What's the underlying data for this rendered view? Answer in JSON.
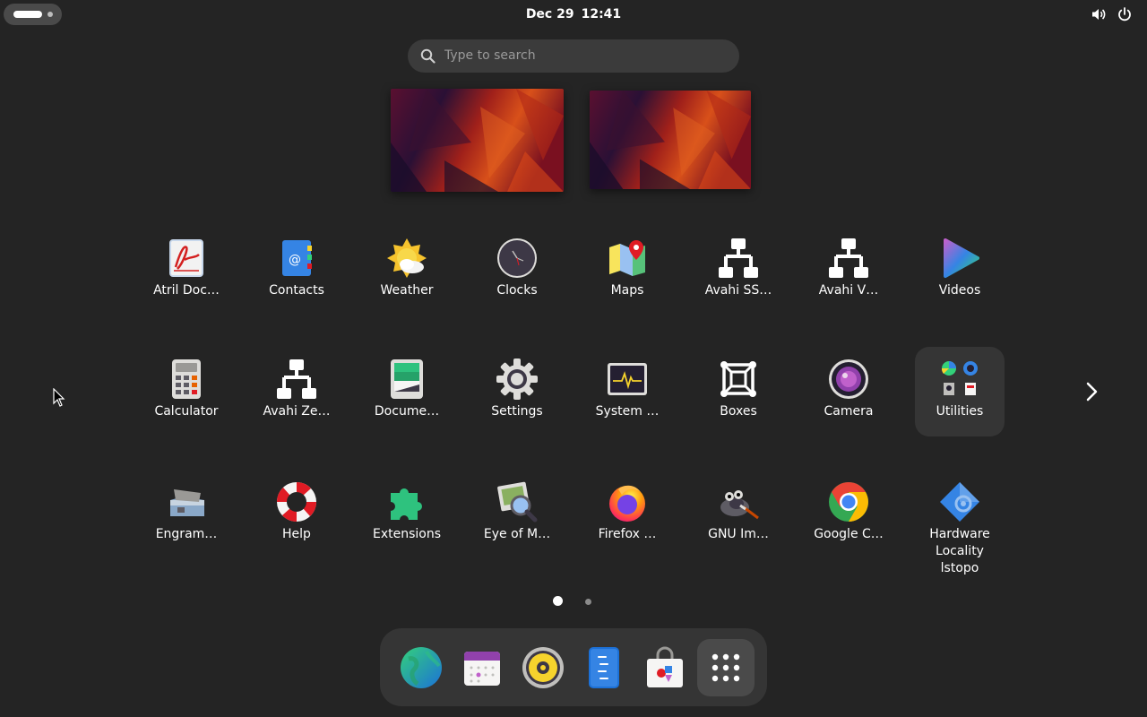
{
  "topbar": {
    "date": "Dec 29",
    "time": "12:41",
    "activities_icon": "activities-pill-icon",
    "volume_icon": "volume-icon",
    "power_icon": "power-icon"
  },
  "search": {
    "placeholder": "Type to search",
    "icon": "search-icon"
  },
  "workspaces": [
    {
      "name": "workspace-1"
    },
    {
      "name": "workspace-2"
    }
  ],
  "apps": [
    {
      "label": "Atril Doc…",
      "icon": "atril-document-viewer-icon"
    },
    {
      "label": "Contacts",
      "icon": "contacts-icon"
    },
    {
      "label": "Weather",
      "icon": "weather-icon"
    },
    {
      "label": "Clocks",
      "icon": "clocks-icon"
    },
    {
      "label": "Maps",
      "icon": "maps-icon"
    },
    {
      "label": "Avahi SS…",
      "icon": "network-icon"
    },
    {
      "label": "Avahi V…",
      "icon": "network-icon"
    },
    {
      "label": "Videos",
      "icon": "videos-icon"
    },
    {
      "label": "Calculator",
      "icon": "calculator-icon"
    },
    {
      "label": "Avahi Ze…",
      "icon": "network-icon"
    },
    {
      "label": "Docume…",
      "icon": "document-scanner-icon"
    },
    {
      "label": "Settings",
      "icon": "settings-gear-icon"
    },
    {
      "label": "System …",
      "icon": "system-monitor-icon"
    },
    {
      "label": "Boxes",
      "icon": "boxes-icon"
    },
    {
      "label": "Camera",
      "icon": "camera-icon"
    },
    {
      "label": "Utilities",
      "icon": "utilities-folder-icon"
    },
    {
      "label": "Engram…",
      "icon": "engrampa-archive-icon"
    },
    {
      "label": "Help",
      "icon": "help-lifebuoy-icon"
    },
    {
      "label": "Extensions",
      "icon": "extensions-puzzle-icon"
    },
    {
      "label": "Eye of M…",
      "icon": "image-viewer-icon"
    },
    {
      "label": "Firefox …",
      "icon": "firefox-icon"
    },
    {
      "label": "GNU Im…",
      "icon": "gimp-icon"
    },
    {
      "label": "Google C…",
      "icon": "chrome-icon"
    },
    {
      "label": "Hardware\nLocality\nlstopo",
      "icon": "hwloc-icon"
    }
  ],
  "pager": {
    "current_page": 1,
    "total_pages": 2,
    "next_icon": "chevron-right-icon"
  },
  "dash": [
    {
      "name": "browser",
      "icon": "globe-browser-icon"
    },
    {
      "name": "calendar",
      "icon": "calendar-icon"
    },
    {
      "name": "music",
      "icon": "music-speaker-icon"
    },
    {
      "name": "text-editor",
      "icon": "text-editor-icon"
    },
    {
      "name": "software",
      "icon": "software-bag-icon"
    },
    {
      "name": "show-apps",
      "icon": "app-grid-icon"
    }
  ],
  "colors": {
    "background": "#242424",
    "search_bg": "#3b3b3b",
    "dash_bg": "#353535",
    "text": "#ffffff"
  }
}
